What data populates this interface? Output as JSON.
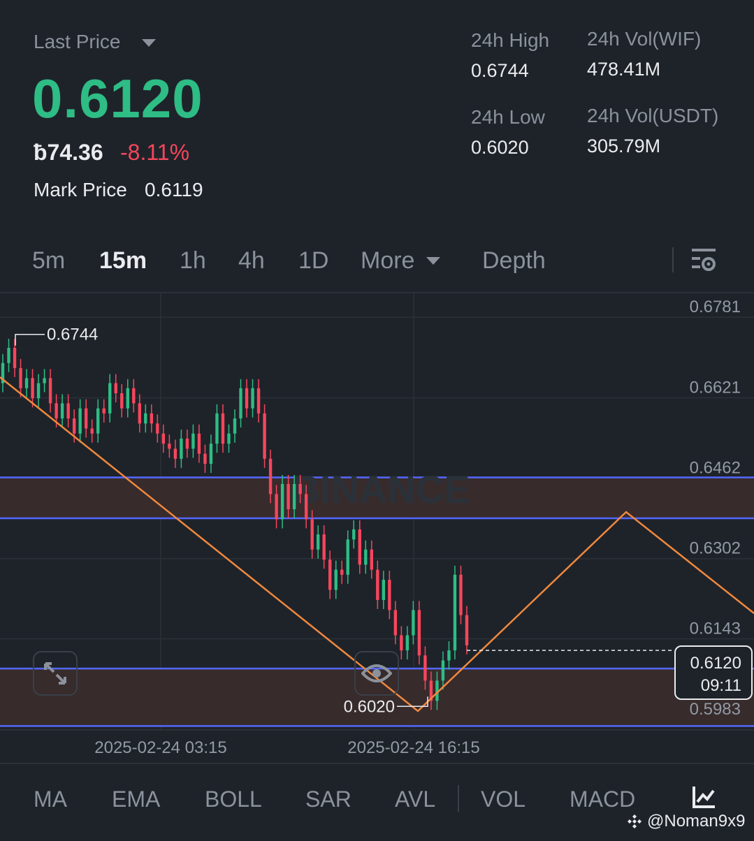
{
  "header": {
    "last_price_label": "Last Price",
    "last_price": "0.6120",
    "local_price": "ƀ74.36",
    "change_pct": "-8.11%",
    "mark_price_label": "Mark Price",
    "mark_price": "0.6119",
    "high_label": "24h High",
    "high_value": "0.6744",
    "low_label": "24h Low",
    "low_value": "0.6020",
    "vol_base_label": "24h Vol(WIF)",
    "vol_base_value": "478.41M",
    "vol_quote_label": "24h Vol(USDT)",
    "vol_quote_value": "305.79M"
  },
  "tabs": {
    "items": [
      {
        "label": "5m",
        "active": false
      },
      {
        "label": "15m",
        "active": true
      },
      {
        "label": "1h",
        "active": false
      },
      {
        "label": "4h",
        "active": false
      },
      {
        "label": "1D",
        "active": false
      },
      {
        "label": "More",
        "active": false
      },
      {
        "label": "Depth",
        "active": false
      }
    ],
    "settings_icon": "chart-settings-icon"
  },
  "chart": {
    "watermark": "BINANCE",
    "price_ticks": [
      "0.6781",
      "0.6621",
      "0.6462",
      "0.6302",
      "0.6143",
      "0.5983"
    ],
    "time_ticks": [
      "2025-02-24 03:15",
      "2025-02-24 16:15"
    ],
    "high_marker": "0.6744",
    "low_marker": "0.6020",
    "current_price": "0.6120",
    "countdown": "09:11",
    "colors": {
      "up": "#2ebd85",
      "down": "#f6465d",
      "trendline": "#f0883e",
      "zone_line": "#5468ff",
      "zone_fill": "#3a2c2c"
    }
  },
  "chart_data": {
    "type": "candlestick",
    "price_range": [
      0.5983,
      0.6781
    ],
    "x_ticks": [
      "2025-02-24 03:15",
      "2025-02-24 16:15"
    ],
    "y_ticks": [
      0.6781,
      0.6621,
      0.6462,
      0.6302,
      0.6143,
      0.5983
    ],
    "high": 0.6744,
    "low": 0.602,
    "last": 0.612,
    "zones": [
      [
        0.6382,
        0.6463
      ],
      [
        0.597,
        0.6084
      ]
    ],
    "candles": [
      [
        0.665,
        0.669
      ],
      [
        0.669,
        0.672
      ],
      [
        0.672,
        0.668
      ],
      [
        0.668,
        0.664
      ],
      [
        0.664,
        0.666
      ],
      [
        0.666,
        0.662
      ],
      [
        0.662,
        0.665
      ],
      [
        0.665,
        0.666
      ],
      [
        0.666,
        0.661
      ],
      [
        0.661,
        0.658
      ],
      [
        0.658,
        0.661
      ],
      [
        0.661,
        0.658
      ],
      [
        0.658,
        0.655
      ],
      [
        0.655,
        0.66
      ],
      [
        0.66,
        0.656
      ],
      [
        0.656,
        0.655
      ],
      [
        0.655,
        0.66
      ],
      [
        0.66,
        0.659
      ],
      [
        0.659,
        0.665
      ],
      [
        0.665,
        0.663
      ],
      [
        0.663,
        0.66
      ],
      [
        0.66,
        0.664
      ],
      [
        0.664,
        0.661
      ],
      [
        0.661,
        0.657
      ],
      [
        0.657,
        0.659
      ],
      [
        0.659,
        0.657
      ],
      [
        0.657,
        0.655
      ],
      [
        0.655,
        0.653
      ],
      [
        0.653,
        0.652
      ],
      [
        0.652,
        0.65
      ],
      [
        0.65,
        0.654
      ],
      [
        0.654,
        0.652
      ],
      [
        0.652,
        0.655
      ],
      [
        0.655,
        0.651
      ],
      [
        0.651,
        0.649
      ],
      [
        0.649,
        0.653
      ],
      [
        0.653,
        0.659
      ],
      [
        0.659,
        0.653
      ],
      [
        0.653,
        0.655
      ],
      [
        0.655,
        0.658
      ],
      [
        0.658,
        0.664
      ],
      [
        0.664,
        0.66
      ],
      [
        0.66,
        0.664
      ],
      [
        0.664,
        0.659
      ],
      [
        0.659,
        0.65
      ],
      [
        0.65,
        0.643
      ],
      [
        0.643,
        0.638
      ],
      [
        0.638,
        0.645
      ],
      [
        0.645,
        0.64
      ],
      [
        0.64,
        0.645
      ],
      [
        0.645,
        0.643
      ],
      [
        0.643,
        0.638
      ],
      [
        0.638,
        0.632
      ],
      [
        0.632,
        0.635
      ],
      [
        0.635,
        0.63
      ],
      [
        0.63,
        0.624
      ],
      [
        0.624,
        0.628
      ],
      [
        0.628,
        0.627
      ],
      [
        0.627,
        0.634
      ],
      [
        0.634,
        0.636
      ],
      [
        0.636,
        0.629
      ],
      [
        0.629,
        0.632
      ],
      [
        0.632,
        0.628
      ],
      [
        0.628,
        0.622
      ],
      [
        0.622,
        0.626
      ],
      [
        0.626,
        0.62
      ],
      [
        0.62,
        0.615
      ],
      [
        0.615,
        0.612
      ],
      [
        0.612,
        0.615
      ],
      [
        0.615,
        0.62
      ],
      [
        0.62,
        0.611
      ],
      [
        0.611,
        0.606
      ],
      [
        0.606,
        0.602
      ],
      [
        0.602,
        0.606
      ],
      [
        0.606,
        0.61
      ],
      [
        0.61,
        0.612
      ],
      [
        0.612,
        0.627
      ],
      [
        0.627,
        0.619
      ],
      [
        0.619,
        0.613
      ]
    ]
  },
  "indicators": {
    "items": [
      "MA",
      "EMA",
      "BOLL",
      "SAR",
      "AVL",
      "VOL",
      "MACD"
    ]
  },
  "watermark_text": "@Noman9x9"
}
